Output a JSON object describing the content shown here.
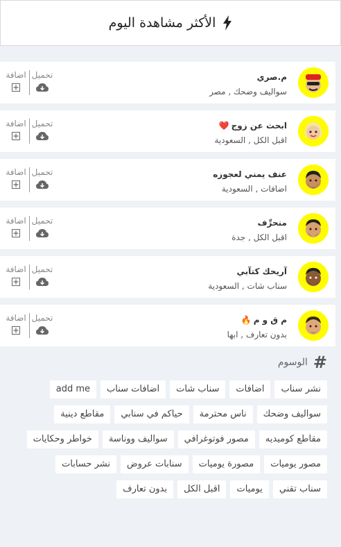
{
  "header": {
    "title": "الأكثر مشاهدة اليوم",
    "icon": "lightning-bolt-icon"
  },
  "actions": {
    "download_label": "تحميل",
    "add_label": "اضافة"
  },
  "accounts": [
    {
      "name": "م.صري",
      "emoji": "",
      "desc": "سواليف وضحك , مصر"
    },
    {
      "name": "ابحث عن زوج",
      "emoji": "❤️",
      "desc": "اقبل الكل , السعودية"
    },
    {
      "name": "عنف يمني لعجوزه",
      "emoji": "",
      "desc": "اضافات , السعودية"
    },
    {
      "name": "منحرِّف",
      "emoji": "",
      "desc": "اقبل الكل , جدة"
    },
    {
      "name": "آريحك كتآبي",
      "emoji": "",
      "desc": "سناب شات , السعودية"
    },
    {
      "name": "م ق و م",
      "emoji": "🔥",
      "desc": "بدون تعارف , ابها"
    }
  ],
  "tags_section": {
    "title": "الوسوم",
    "items": [
      "نشر سناب",
      "اضافات",
      "سناب شات",
      "اضافات سناب",
      "add me",
      "سواليف وضحك",
      "ناس محترمة",
      "حياكم في سنابي",
      "مقاطع دينية",
      "مقاطع كوميديه",
      "مصور فوتوغرافي",
      "سواليف ووناسة",
      "خواطر وحكايات",
      "مصور يوميات",
      "مصورة يوميات",
      "سنابات عروض",
      "نشر حسابات",
      "سناب تقني",
      "يوميات",
      "اقبل الكل",
      "بدون تعارف"
    ]
  }
}
